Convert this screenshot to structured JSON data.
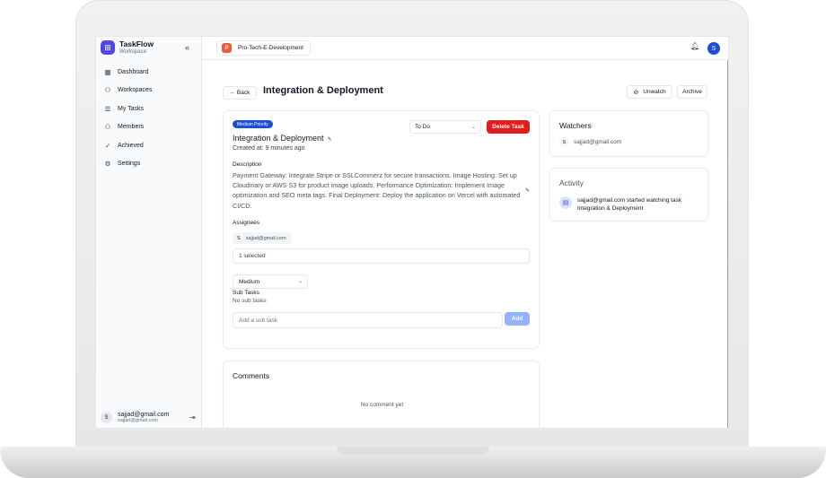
{
  "sidebar": {
    "brand": {
      "name": "TaskFlow",
      "subtitle": "Workspace"
    },
    "collapse_icon": "double-chevron-left-icon",
    "items": [
      {
        "label": "Dashboard",
        "icon": "grid-icon"
      },
      {
        "label": "Workspaces",
        "icon": "users-icon"
      },
      {
        "label": "My Tasks",
        "icon": "list-icon"
      },
      {
        "label": "Members",
        "icon": "users-icon"
      },
      {
        "label": "Achieved",
        "icon": "check-circle-icon"
      },
      {
        "label": "Settings",
        "icon": "gear-icon"
      }
    ],
    "user": {
      "avatar": "S",
      "name": "sajjad@gmail.com",
      "email": "sajjad@gmail.com"
    }
  },
  "topbar": {
    "project_badge": "P",
    "project_name": "Pro-Tech-E-Development",
    "avatar": "S"
  },
  "header": {
    "back_label": "← Back",
    "title": "Integration & Deployment",
    "unwatch_label": "Unwatch",
    "archive_label": "Archive"
  },
  "task": {
    "priority": "Medium Priority",
    "title": "Integration & Deployment",
    "created": "Created at: 9 minutes ago",
    "status": "To Do",
    "delete_label": "Delete Task",
    "description_label": "Description",
    "description": "Payment Gateway: Integrate Stripe or SSLCommerz for secure transactions. Image Hosting: Set up Cloudinary or AWS S3 for product image uploads. Performance Optimization: Implement Image optimization and SEO meta tags. Final Deployment: Deploy the application on Vercel with automated CI/CD.",
    "assignees_label": "Assignees",
    "assignee": {
      "avatar": "S",
      "email": "sajjad@gmail.com"
    },
    "assignee_select": "1 selected",
    "priority_select": "Medium",
    "subtasks_label": "Sub Tasks",
    "subtasks_empty": "No sub tasks",
    "subtask_placeholder": "Add a sub task",
    "add_label": "Add"
  },
  "comments": {
    "title": "Comments",
    "empty": "No comment yet"
  },
  "watchers": {
    "title": "Watchers",
    "items": [
      {
        "avatar": "S",
        "email": "sajjad@gmail.com"
      }
    ]
  },
  "activity": {
    "title": "Activity",
    "items": [
      {
        "icon": "document-icon",
        "line1": "sajjad@gmail.com started watching task",
        "line2": "Integration & Deployment"
      }
    ]
  },
  "colors": {
    "brand": "#4f46e5",
    "primary": "#1d4ed8",
    "danger": "#e11d1d",
    "project": "#f05a3b",
    "add_disabled": "#93b4f8"
  }
}
